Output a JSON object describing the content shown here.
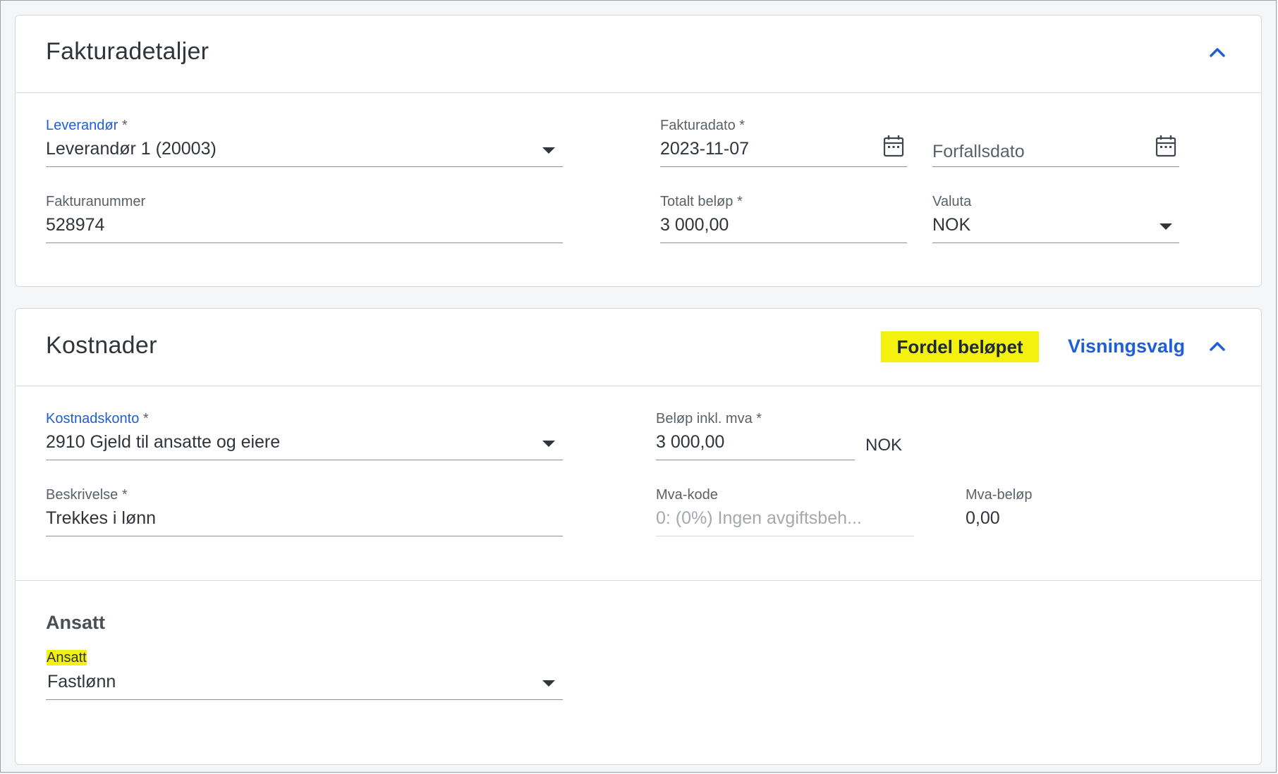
{
  "invoice_card": {
    "title": "Fakturadetaljer",
    "collapse_icon": "chevron-up-icon",
    "supplier": {
      "label": "Leverandør",
      "required": "*",
      "value": "Leverandør 1 (20003)"
    },
    "invoice_date": {
      "label": "Fakturadato",
      "required": "*",
      "value": "2023-11-07"
    },
    "due_date": {
      "placeholder": "Forfallsdato"
    },
    "invoice_number": {
      "label": "Fakturanummer",
      "value": "528974"
    },
    "total_amount": {
      "label": "Totalt beløp",
      "required": "*",
      "value": "3 000,00"
    },
    "currency": {
      "label": "Valuta",
      "value": "NOK"
    }
  },
  "costs_card": {
    "title": "Kostnader",
    "distribute_button": "Fordel beløpet",
    "view_options_link": "Visningsvalg",
    "collapse_icon": "chevron-up-icon",
    "cost_account": {
      "label": "Kostnadskonto",
      "required": "*",
      "value": "2910 Gjeld til ansatte og eiere"
    },
    "amount_incl_vat": {
      "label": "Beløp inkl. mva",
      "required": "*",
      "value": "3 000,00",
      "unit": "NOK"
    },
    "description": {
      "label": "Beskrivelse",
      "required": "*",
      "value": "Trekkes i lønn"
    },
    "vat_code": {
      "label": "Mva-kode",
      "value": "0: (0%) Ingen avgiftsbeh..."
    },
    "vat_amount": {
      "label": "Mva-beløp",
      "value": "0,00"
    },
    "employee_section": {
      "heading": "Ansatt",
      "employee": {
        "label": "Ansatt",
        "value": "Fastlønn"
      }
    }
  },
  "colors": {
    "accent": "#1f5fd6",
    "highlight": "#f5f10f",
    "text": "#30353b"
  }
}
